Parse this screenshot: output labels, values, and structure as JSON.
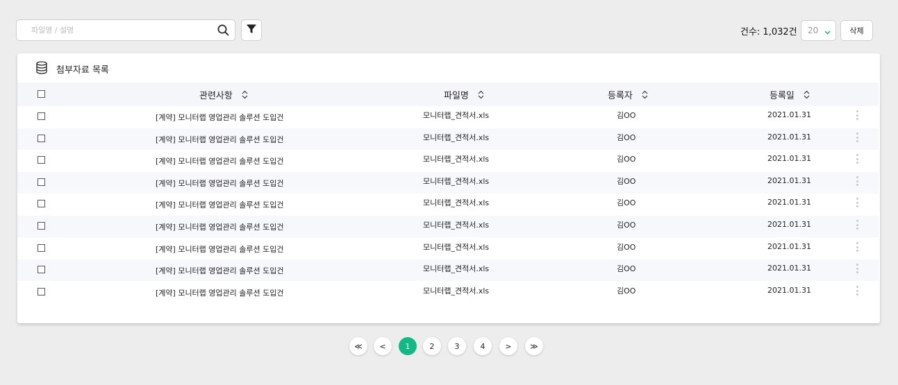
{
  "search": {
    "placeholder": "파일명 / 설명",
    "value": ""
  },
  "toolbar": {
    "count_label": "건수: 1,032건",
    "page_size": "20",
    "delete_label": "삭제"
  },
  "list": {
    "title": "첨부자료 목록",
    "columns": [
      "관련사항",
      "파일명",
      "등록자",
      "등록일"
    ],
    "rows": [
      {
        "subject": "[계약] 모니터랩 영업관리 솔루션 도입건",
        "file": "모니터랩_견적서.xls",
        "author": "김OO",
        "date": "2021.01.31"
      },
      {
        "subject": "[계약] 모니터랩 영업관리 솔루션 도입건",
        "file": "모니터랩_견적서.xls",
        "author": "김OO",
        "date": "2021.01.31"
      },
      {
        "subject": "[계약] 모니터랩 영업관리 솔루션 도입건",
        "file": "모니터랩_견적서.xls",
        "author": "김OO",
        "date": "2021.01.31"
      },
      {
        "subject": "[계약] 모니터랩 영업관리 솔루션 도입건",
        "file": "모니터랩_견적서.xls",
        "author": "김OO",
        "date": "2021.01.31"
      },
      {
        "subject": "[계약] 모니터랩 영업관리 솔루션 도입건",
        "file": "모니터랩_견적서.xls",
        "author": "김OO",
        "date": "2021.01.31"
      },
      {
        "subject": "[계약] 모니터랩 영업관리 솔루션 도입건",
        "file": "모니터랩_견적서.xls",
        "author": "김OO",
        "date": "2021.01.31"
      },
      {
        "subject": "[계약] 모니터랩 영업관리 솔루션 도입건",
        "file": "모니터랩_견적서.xls",
        "author": "김OO",
        "date": "2021.01.31"
      },
      {
        "subject": "[계약] 모니터랩 영업관리 솔루션 도입건",
        "file": "모니터랩_견적서.xls",
        "author": "김OO",
        "date": "2021.01.31"
      },
      {
        "subject": "[계약] 모니터랩 영업관리 솔루션 도입건",
        "file": "모니터랩_견적서.xls",
        "author": "김OO",
        "date": "2021.01.31"
      }
    ]
  },
  "pagination": {
    "first": "≪",
    "prev": "<",
    "pages": [
      "1",
      "2",
      "3",
      "4"
    ],
    "current": "1",
    "next": ">",
    "last": "≫"
  },
  "colors": {
    "accent": "#13b985",
    "background": "#ededed"
  },
  "icons": [
    "search-icon",
    "filter-icon",
    "chevron-down-icon",
    "database-icon",
    "sort-icon",
    "more-vertical-icon"
  ]
}
